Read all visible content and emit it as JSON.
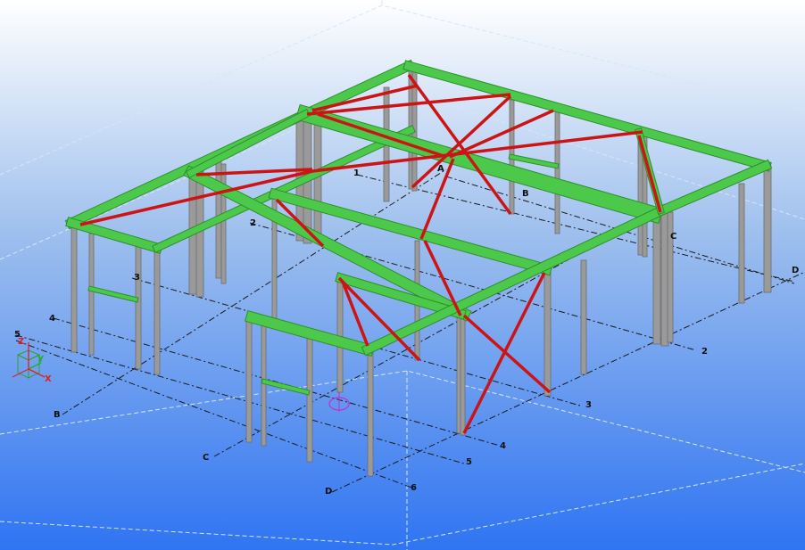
{
  "colors": {
    "sky_top": "#ffffff",
    "sky_mid": "#9fc0ee",
    "sky_bottom": "#2f74f2",
    "beam_green": "#4cc94a",
    "beam_green_dark": "#2e8f2c",
    "brace_red": "#cc1414",
    "column_grey": "#9a9a9a",
    "column_dark": "#6c6c6c",
    "grid_line": "#1a1a1a",
    "work_area": "#d6e6f4"
  },
  "grid_labels": {
    "letters_main": [
      "B",
      "C",
      "D"
    ],
    "letters_upper": [
      "A",
      "B",
      "C",
      "D"
    ],
    "numbers_main": [
      "2",
      "3",
      "4",
      "5",
      "6"
    ],
    "numbers_left": [
      "1",
      "2",
      "3",
      "4",
      "5"
    ]
  },
  "axes": {
    "z": "Z",
    "y": "Y",
    "x": "X"
  },
  "icons": {
    "view_center": "rotation-center-icon",
    "axes": "coordinate-axes-icon"
  }
}
